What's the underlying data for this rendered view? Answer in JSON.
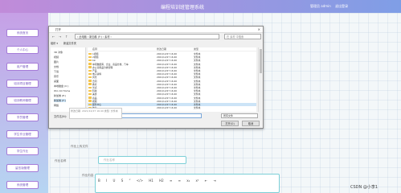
{
  "header": {
    "app_title": "编程培训班管理系统",
    "welcome": "管理员 admin",
    "logout": "退出登录"
  },
  "sidebar": {
    "items": [
      "系统首页",
      "个人中心",
      "用户管理",
      "培训项目管理",
      "培训教师管理",
      "学员管理",
      "学生作业管理",
      "学生作业",
      "留言版管理",
      "系统管理"
    ]
  },
  "breadcrumb": {
    "home": "首页",
    "current": "学生作业"
  },
  "form": {
    "file_label": "作业上传文件",
    "name_label": "作业名称",
    "name_placeholder": "作业名称",
    "content_label": "作业内容",
    "editor_tools": [
      "B",
      "I",
      "U",
      "S",
      "“",
      "</>",
      "H1",
      "H2",
      "≡",
      "≡",
      "x₂",
      "x²",
      "⇤",
      "⇥"
    ]
  },
  "dialog": {
    "title": "打开",
    "close": "×",
    "nav": {
      "back": "←",
      "forward": "→",
      "up": "↑"
    },
    "address": "› 此电脑 › 新加卷 (F:) › 素材 ›",
    "search_placeholder": "在 素材 中搜索",
    "toolbar": [
      "组织 ▾",
      "新建文件夹"
    ],
    "tree": [
      "3D 对象",
      "视频",
      "图片",
      "文档",
      "下载",
      "音乐",
      "桌面",
      "本地磁盘 (C:)",
      "Win 10 Home",
      "新加卷 (E:)",
      "新加卷 (F:)",
      "网络"
    ],
    "columns": {
      "name": "名称",
      "date": "修改日期",
      "type": "类型"
    },
    "files": [
      {
        "name": "1视频",
        "date": "2021/12/27 16:40",
        "type": "文件夹"
      },
      {
        "name": "2视频",
        "date": "2021/12/27 16:40",
        "type": "文件夹"
      },
      {
        "name": "bin",
        "date": "2021/12/27 16:40",
        "type": "文件夹"
      },
      {
        "name": "单项数据库、企业、商品分类、汽车",
        "date": "2021/12/27 16:40",
        "type": "文件夹"
      },
      {
        "name": "办公室用品分类管理",
        "date": "2021/12/27 16:40",
        "type": "文件夹"
      },
      {
        "name": "产品",
        "date": "2021/12/27 16:40",
        "type": "文件夹"
      },
      {
        "name": "电子资料",
        "date": "2021/12/27 16:40",
        "type": "文件夹"
      },
      {
        "name": "风景",
        "date": "2021/12/27 16:40",
        "type": "文件夹"
      },
      {
        "name": "合同",
        "date": "2021/12/27 16:40",
        "type": "文件夹"
      },
      {
        "name": "教育",
        "date": "2021/12/27 16:40",
        "type": "文件夹"
      },
      {
        "name": "景点",
        "date": "2021/12/27 16:40",
        "type": "文件夹"
      },
      {
        "name": "科技",
        "date": "2021/12/27 16:40",
        "type": "文件夹"
      },
      {
        "name": "美食",
        "date": "2021/12/27 16:40",
        "type": "文件夹"
      },
      {
        "name": "商品",
        "date": "2021/12/27 16:40",
        "type": "文件夹"
      },
      {
        "name": "视频",
        "date": "2021/12/27 16:40",
        "type": "文件夹"
      },
      {
        "name": "服务中心",
        "date": "2021/12/27 16:40",
        "type": "文件夹"
      },
      {
        "name": "作业",
        "date": "2021/12/27 16:40",
        "type": "文件夹"
      }
    ],
    "filename_label": "文件名(N):",
    "filter": "所有文件",
    "open_button": "打开(O)",
    "cancel_button": "取消"
  },
  "tooltip": "修改日期: 2021/12/27 16:40\n类型: 文件夹",
  "watermark": "CSDN @小李1"
}
